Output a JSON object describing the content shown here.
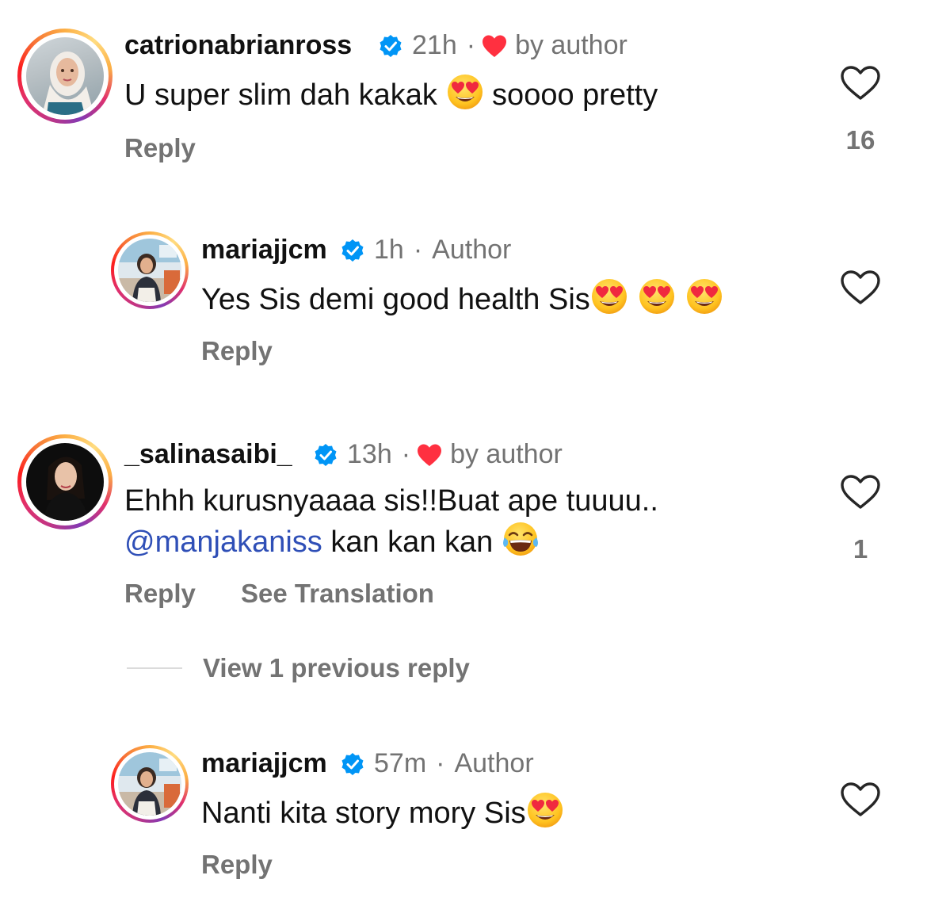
{
  "comments": [
    {
      "username": "catrionabrianross",
      "time": "21h",
      "separator": "·",
      "liked_label": "by author",
      "text_before": "U super slim dah kakak ",
      "emoji1": "heart-eyes-emoji",
      "text_after": " soooo pretty",
      "reply_label": "Reply",
      "like_count": "16"
    },
    {
      "username": "mariajjcm",
      "time": "1h",
      "separator": "·",
      "author_label": "Author",
      "text": "Yes Sis demi good health Sis",
      "emoji": "heart-eyes-emoji",
      "reply_label": "Reply"
    },
    {
      "username": "_salinasaibi_",
      "time": "13h",
      "separator": "·",
      "liked_label": "by author",
      "text_line1": "Ehhh kurusnyaaaa sis!!Buat ape tuuuu..",
      "mention": "@manjakaniss",
      "text_line2_after": " kan kan kan ",
      "emoji": "tears-of-joy-emoji",
      "reply_label": "Reply",
      "translate_label": "See Translation",
      "like_count": "1",
      "view_replies_label": "View 1 previous reply"
    },
    {
      "username": "mariajjcm",
      "time": "57m",
      "separator": "·",
      "author_label": "Author",
      "text": "Nanti kita story mory Sis",
      "emoji": "heart-eyes-emoji",
      "reply_label": "Reply"
    }
  ],
  "colors": {
    "verified": "#0095f6",
    "liked_heart": "#ff3040",
    "mention": "#2f4fb7",
    "secondary_text": "#737373"
  }
}
